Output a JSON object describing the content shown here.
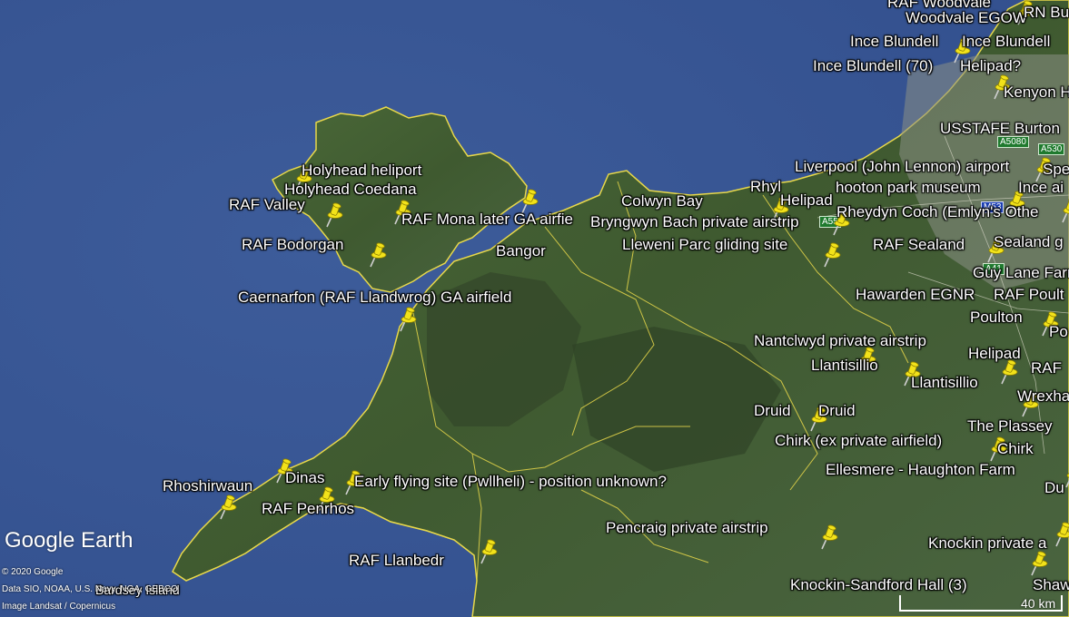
{
  "colors": {
    "sea": "#3a5896",
    "land": "#3f5a32",
    "border": "#e8d84a",
    "label": "#ffffff",
    "pin": "#f2e21a"
  },
  "labels": {
    "holyhead_heliport": "Holyhead heliport",
    "holyhead_coedana": "Holyhead  Coedana",
    "raf_valley": "RAF Valley",
    "raf_mona": "RAF Mona later GA airfie",
    "bangor": "Bangor",
    "raf_bodorgan": "RAF Bodorgan",
    "caernarfon": "Caernarfon (RAF Llandwrog) GA airfield",
    "colwyn_bay": "Colwyn Bay",
    "bryngwyn_bach": "Bryngwyn Bach private airstrip",
    "rhyl": "Rhyl",
    "helipad_rhyl": "Helipad",
    "lleweni_parc": "Lleweni Parc gliding site",
    "rheydyn_coch": "Rheydyn Coch (Emlyn's Othe",
    "raf_sealand": "RAF Sealand",
    "sealand": "Sealand g",
    "guy_lane": "Guy Lane Farm",
    "hawarden": "Hawarden EGNR",
    "raf_poulton": "RAF Poult",
    "poulton": "Poulton",
    "po": "Po",
    "nantclwyd": "Nantclwyd private airstrip",
    "llantisillio_1": "Llantisillio",
    "llantisillio_2": "Llantisillio",
    "helipad_2": "Helipad",
    "raf_right": "RAF",
    "wrexham": "Wrexha",
    "druid_1": "Druid",
    "druid_2": "Druid",
    "the_plassey": "The Plassey",
    "chirk_ex": "Chirk (ex private airfield)",
    "chirk": "Chirk",
    "ellesmere": "Ellesmere - Haughton Farm",
    "du": "Du",
    "rhoshirwaun": "Rhoshirwaun",
    "dinas": "Dinas",
    "early_flying": "Early flying site (Pwllheli) - position unknown?",
    "raf_penrhos": "RAF Penrhos",
    "pencraig": "Pencraig private airstrip",
    "knockin": "Knockin private a",
    "raf_llanbedr": "RAF Llanbedr",
    "knockin_sandford": "Knockin-Sandford Hall (3)",
    "shaw": "Shaw",
    "bardsey": "Bardsey Island",
    "liverpool": "Liverpool (John Lennon) airport",
    "spe": "Spe",
    "hooton": "hooton park museum",
    "ince_ai": "Ince ai",
    "usstafe": "USSTAFE Burton",
    "kenyon": "Kenyon H",
    "helipad_q": "Helipad?",
    "ince_blundell_70": "Ince Blundell (70)",
    "ince_blundell_a": "Ince Blundell",
    "ince_blundell_b": "Ince Blundell",
    "woodvale_egow": "Woodvale EGOW",
    "raf_woodvale": "RAF Woodvale",
    "rn_bu": "RN Bu"
  },
  "roads": {
    "a5080": "A5080",
    "a530": "A530",
    "a55": "A55",
    "m53": "M53",
    "a41": "A41"
  },
  "brand": "Google Earth",
  "credits": [
    "© 2020 Google",
    "Data SIO, NOAA, U.S. Navy, NGA, GEBCO",
    "Image Landsat / Copernicus"
  ],
  "scale": "40 km"
}
